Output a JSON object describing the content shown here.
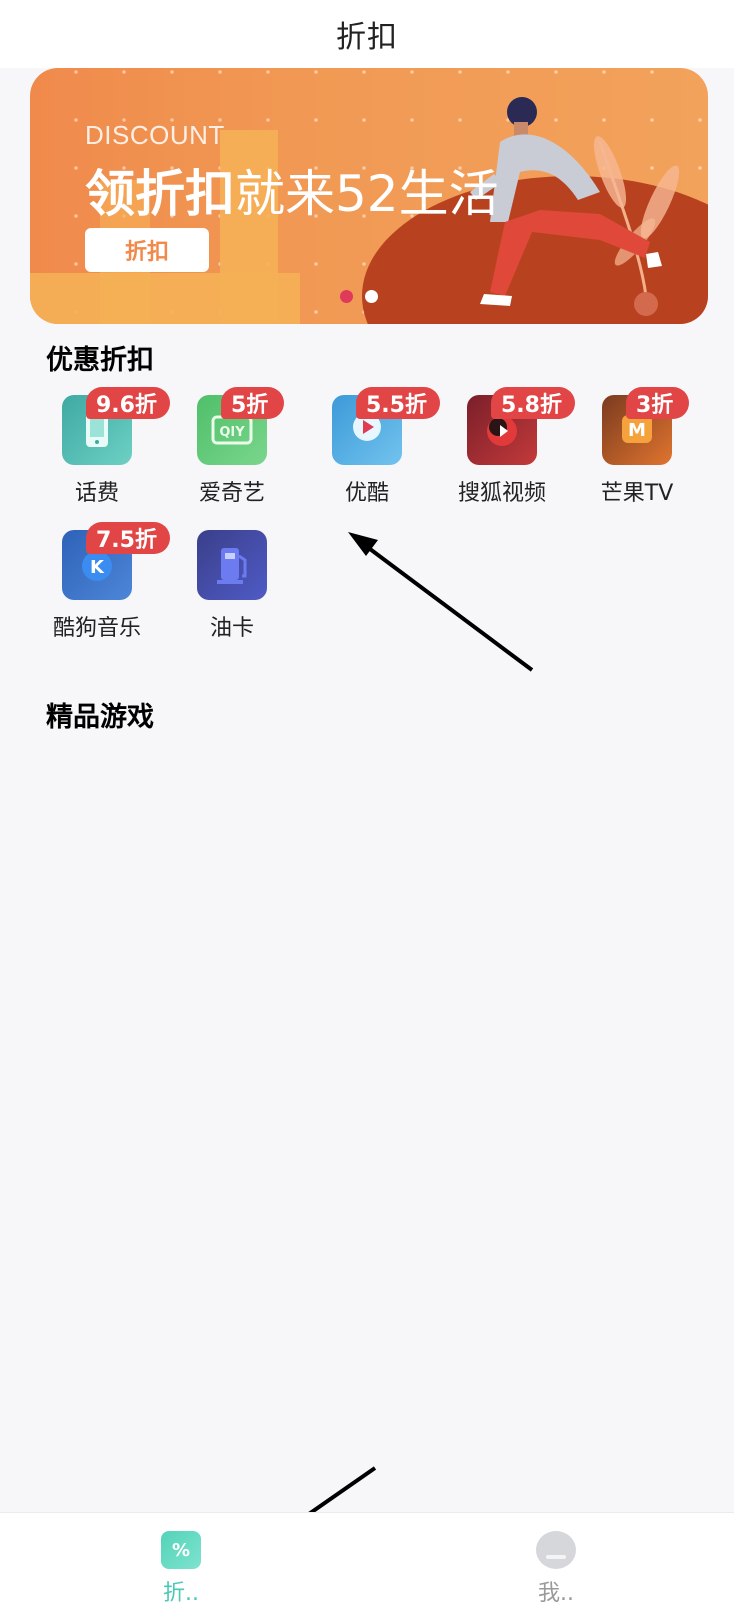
{
  "header": {
    "title": "折扣"
  },
  "banner": {
    "eyebrow": "DISCOUNT",
    "headline_bold": "领折扣",
    "headline_rest": "就来52生活",
    "cta_label": "折扣",
    "pager": {
      "total": 2,
      "active": 1
    },
    "colors": {
      "active_dot": "#e03a5a",
      "inactive_dot": "#ffffff"
    }
  },
  "discounts": {
    "title": "优惠折扣",
    "items": [
      {
        "name": "话费",
        "badge": "9.6折",
        "icon": "phone-icon"
      },
      {
        "name": "爱奇艺",
        "badge": "5折",
        "icon": "iqiyi-icon"
      },
      {
        "name": "优酷",
        "badge": "5.5折",
        "icon": "youku-icon"
      },
      {
        "name": "搜狐视频",
        "badge": "5.8折",
        "icon": "sohu-video-icon"
      },
      {
        "name": "芒果TV",
        "badge": "3折",
        "icon": "mango-tv-icon"
      },
      {
        "name": "酷狗音乐",
        "badge": "7.5折",
        "icon": "kugou-icon"
      },
      {
        "name": "油卡",
        "badge": "",
        "icon": "fuel-card-icon"
      }
    ]
  },
  "games": {
    "title": "精品游戏"
  },
  "tabbar": {
    "items": [
      {
        "label": "折..",
        "icon": "discount-percent-icon",
        "active": true
      },
      {
        "label": "我..",
        "icon": "profile-icon",
        "active": false
      }
    ],
    "colors": {
      "active": "#4cc9b6",
      "inactive": "#9a9a9a",
      "dots": "#e14545"
    }
  }
}
